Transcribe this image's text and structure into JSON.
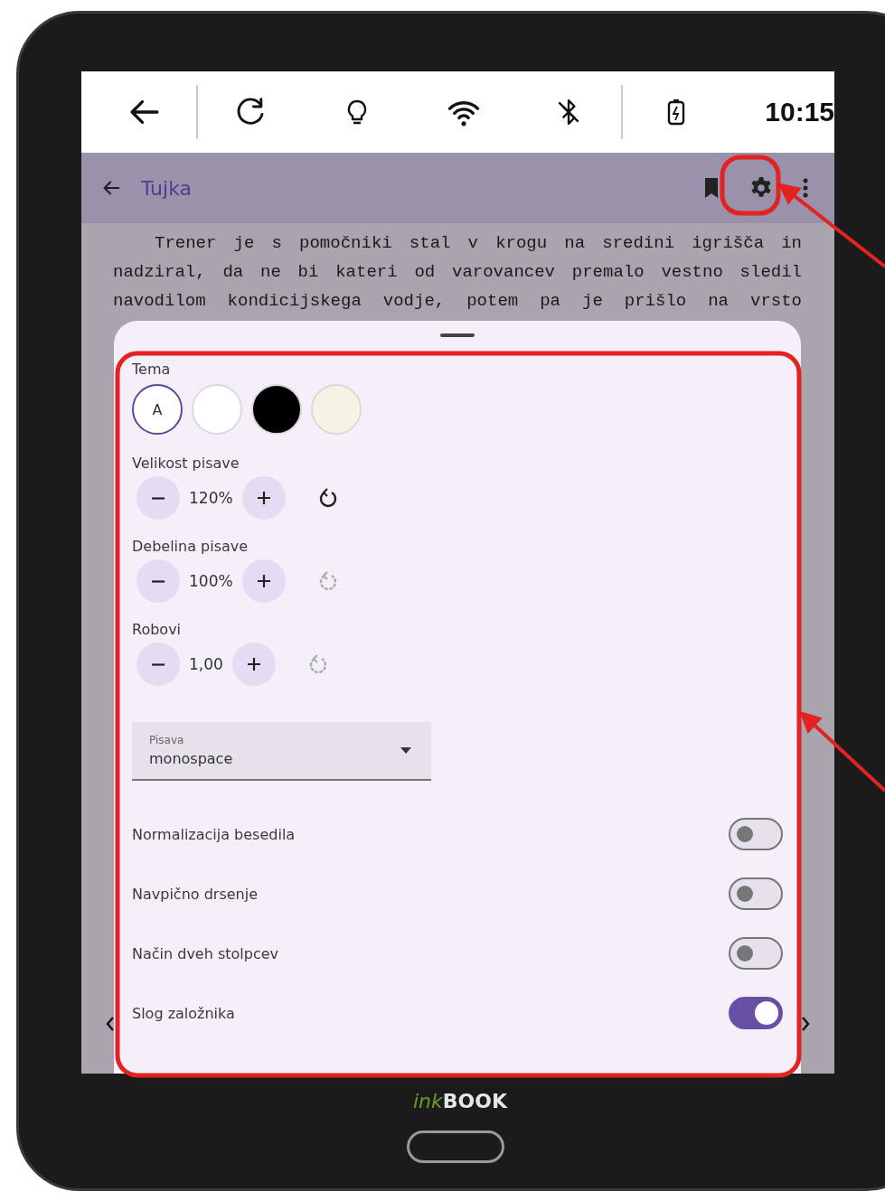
{
  "status_bar": {
    "time": "10:15"
  },
  "app_bar": {
    "title": "Tujka"
  },
  "reader_text": [
    "Trener je s pomočniki stal v krogu na sredini igrišča in",
    "nadziral, da ne bi kateri od varovancev premalo vestno sledil",
    "navodilom kondicijskega vodje, potem pa je prišlo na vrsto"
  ],
  "settings": {
    "theme": {
      "label": "Tema",
      "options": [
        {
          "kind": "auto",
          "text": "A",
          "selected": true
        },
        {
          "kind": "color",
          "color": "#ffffff",
          "selected": false
        },
        {
          "kind": "color",
          "color": "#000000",
          "selected": false
        },
        {
          "kind": "color",
          "color": "#f5f3e4",
          "selected": false
        }
      ]
    },
    "steppers": [
      {
        "label": "Velikost pisave",
        "value": "120%",
        "reset_enabled": true
      },
      {
        "label": "Debelina pisave",
        "value": "100%",
        "reset_enabled": false
      },
      {
        "label": "Robovi",
        "value": "1,00",
        "reset_enabled": false
      }
    ],
    "font_select": {
      "label": "Pisava",
      "value": "monospace"
    },
    "toggles": [
      {
        "label": "Normalizacija besedila",
        "on": false
      },
      {
        "label": "Navpično drsenje",
        "on": false
      },
      {
        "label": "Način dveh stolpcev",
        "on": false
      },
      {
        "label": "Slog založnika",
        "on": true
      }
    ]
  },
  "logo": {
    "prefix": "ink",
    "name": "BOOK"
  }
}
